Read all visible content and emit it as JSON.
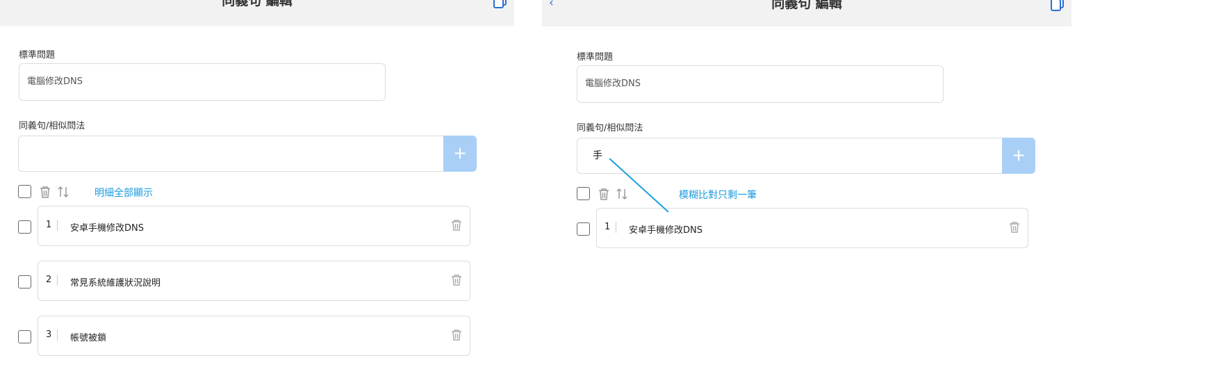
{
  "colors": {
    "accent": "#1a9be0",
    "add_button": "#a9cff6",
    "header_bg": "#f2f2f2",
    "annotation": "#1aa0dd"
  },
  "left": {
    "title": "同義句 編輯",
    "std_label": "標準問題",
    "std_value": "電腦修改DNS",
    "syn_label": "同義句/相似問法",
    "syn_input_value": "",
    "add_symbol": "+",
    "show_all_link": "明細全部顯示",
    "items": [
      {
        "num": "1",
        "text": "安卓手機修改DNS"
      },
      {
        "num": "2",
        "text": "常見系統維護狀況說明"
      },
      {
        "num": "3",
        "text": "帳號被鎖"
      }
    ]
  },
  "right": {
    "title": "同義句 編輯",
    "back_symbol": "‹",
    "std_label": "標準問題",
    "std_value": "電腦修改DNS",
    "syn_label": "同義句/相似問法",
    "syn_input_value": "手",
    "add_symbol": "+",
    "annotation": "模糊比對只剩一筆",
    "items": [
      {
        "num": "1",
        "text": "安卓手機修改DNS"
      }
    ]
  },
  "icons": {
    "copy": "copy-icon",
    "trash": "trash-icon",
    "sort": "sort-icon",
    "back": "chevron-left-icon"
  }
}
